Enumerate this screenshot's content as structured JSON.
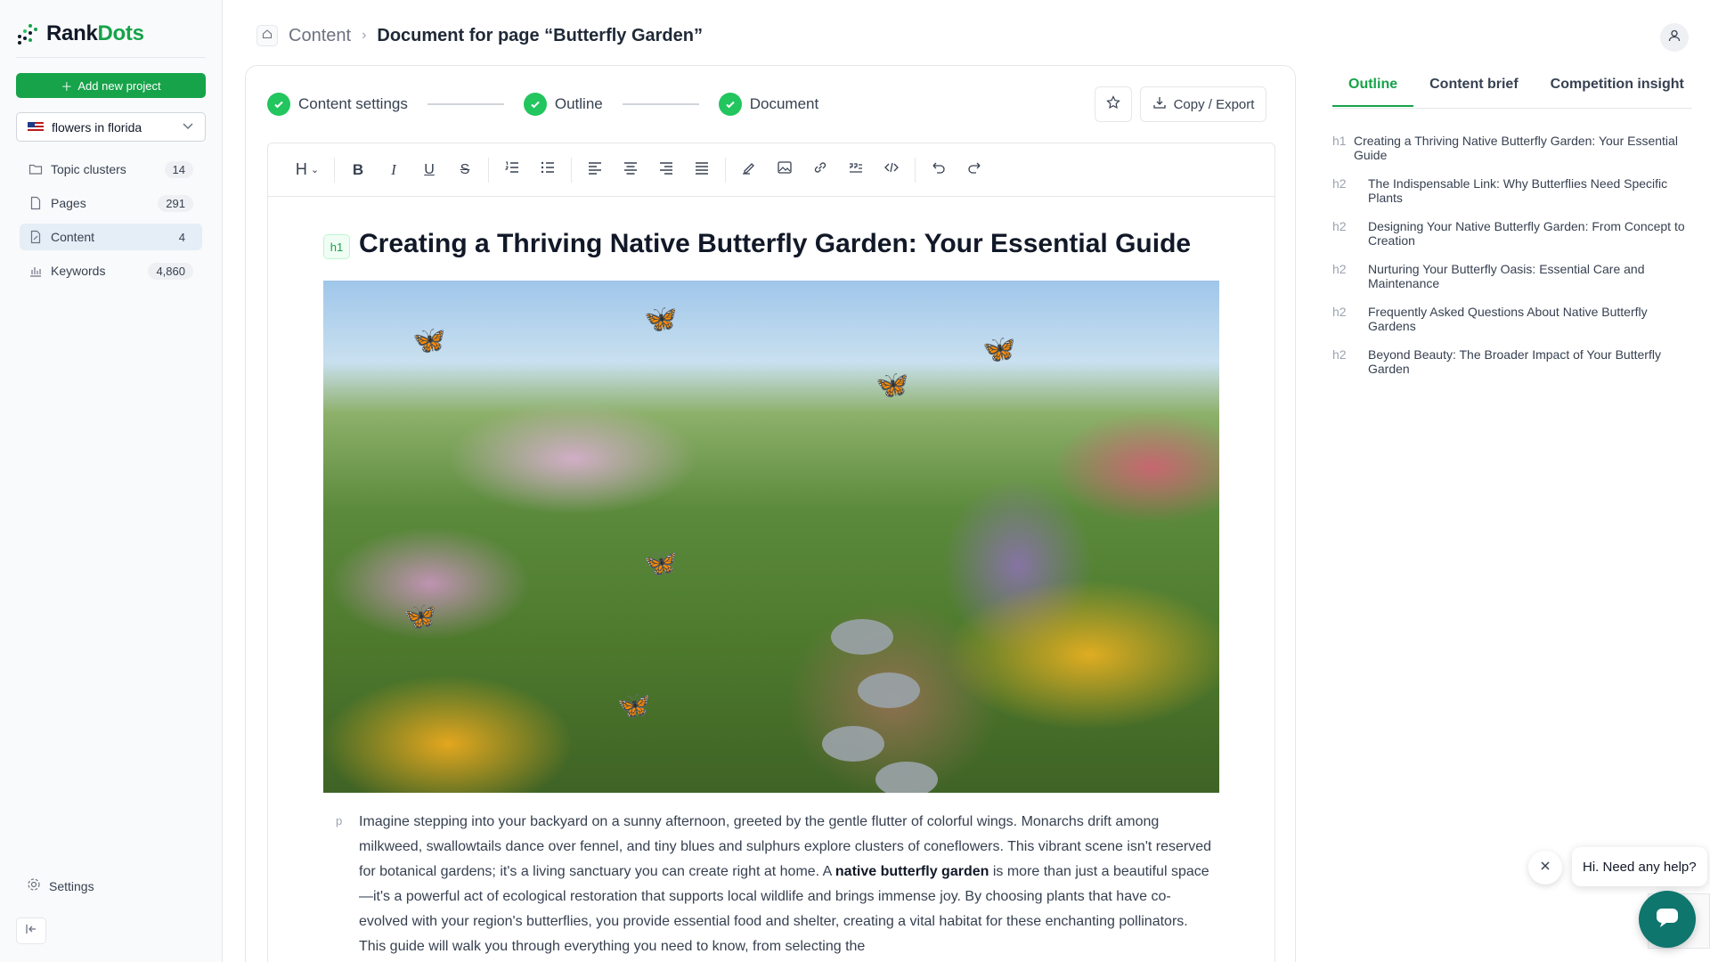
{
  "app": {
    "logo_part1": "Rank",
    "logo_part2": "Dots",
    "accent": "#16a34a"
  },
  "sidebar": {
    "add_project_label": "Add new project",
    "project": "flowers in florida",
    "items": [
      {
        "label": "Topic clusters",
        "count": "14",
        "icon": "folder-icon"
      },
      {
        "label": "Pages",
        "count": "291",
        "icon": "document-icon"
      },
      {
        "label": "Content",
        "count": "4",
        "icon": "edit-document-icon"
      },
      {
        "label": "Keywords",
        "count": "4,860",
        "icon": "bar-chart-icon"
      }
    ],
    "settings_label": "Settings"
  },
  "header": {
    "crumb": "Content",
    "title": "Document for page “Butterfly Garden”"
  },
  "steps": [
    {
      "label": "Content settings"
    },
    {
      "label": "Outline"
    },
    {
      "label": "Document"
    }
  ],
  "actions": {
    "export_label": "Copy / Export"
  },
  "toolbar": {
    "heading_label": "H"
  },
  "document": {
    "h1_tag": "h1",
    "h1": "Creating a Thriving Native Butterfly Garden: Your Essential Guide",
    "p_tag": "p",
    "para_part1": "Imagine stepping into your backyard on a sunny afternoon, greeted by the gentle flutter of colorful wings. Monarchs drift among milkweed, swallowtails dance over fennel, and tiny blues and sulphurs explore clusters of coneflowers. This vibrant scene isn't reserved for botanical gardens; it's a living sanctuary you can create right at home. A ",
    "para_bold": "native butterfly garden",
    "para_part2": " is more than just a beautiful space—it's a powerful act of ecological restoration that supports local wildlife and brings immense joy. By choosing plants that have co-evolved with your region's butterflies, you provide essential food and shelter, creating a vital habitat for these enchanting pollinators. This guide will walk you through everything you need to know, from selecting the"
  },
  "right_panel": {
    "tabs": [
      {
        "label": "Outline"
      },
      {
        "label": "Content brief"
      },
      {
        "label": "Competition insight"
      }
    ],
    "outline": [
      {
        "tag": "h1",
        "text": "Creating a Thriving Native Butterfly Garden: Your Essential Guide"
      },
      {
        "tag": "h2",
        "text": "The Indispensable Link: Why Butterflies Need Specific Plants"
      },
      {
        "tag": "h2",
        "text": "Designing Your Native Butterfly Garden: From Concept to Creation"
      },
      {
        "tag": "h2",
        "text": "Nurturing Your Butterfly Oasis: Essential Care and Maintenance"
      },
      {
        "tag": "h2",
        "text": "Frequently Asked Questions About Native Butterfly Gardens"
      },
      {
        "tag": "h2",
        "text": "Beyond Beauty: The Broader Impact of Your Butterfly Garden"
      }
    ]
  },
  "chat": {
    "greeting": "Hi. Need any help?"
  }
}
